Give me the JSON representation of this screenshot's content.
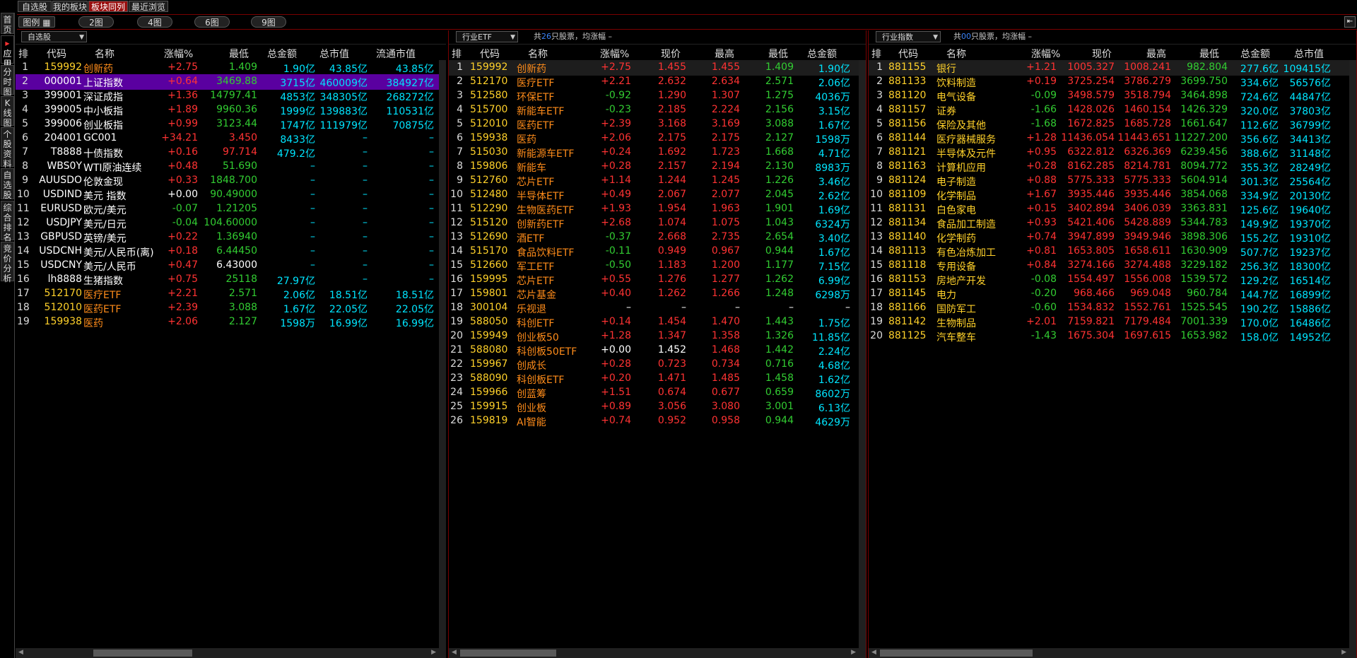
{
  "top_tabs": [
    "自选股",
    "我的板块",
    "板块同列",
    "最近浏览"
  ],
  "active_top_tab": 2,
  "bar2": {
    "legend": "图例 ▦",
    "views": [
      "2图",
      "4图",
      "6图",
      "9图"
    ]
  },
  "left_tabs": [
    "首页",
    "应用",
    "分时图",
    "K线图",
    "个股资料",
    "自选股",
    "综合排名",
    "竞价分析"
  ],
  "panels": [
    {
      "dropdown": "自选股",
      "info_prefix": "",
      "info_count": "",
      "info_suffix": "",
      "columns": [
        "排",
        "代码",
        "名称",
        "涨幅%",
        "最低",
        "总金额",
        "总市值",
        "流通市值"
      ],
      "rows": [
        {
          "i": "1",
          "code": "159992",
          "name": "创新药",
          "chg": "+2.75",
          "c1": "1.409",
          "c2": "1.90亿",
          "c3": "43.85亿",
          "c4": "43.85亿"
        },
        {
          "i": "2",
          "code": "000001",
          "name": "上证指数",
          "chg": "+0.64",
          "c1": "3469.88",
          "c2": "3715亿",
          "c3": "460009亿",
          "c4": "384927亿"
        },
        {
          "i": "3",
          "code": "399001",
          "name": "深证成指",
          "chg": "+1.36",
          "c1": "14797.41",
          "c2": "4853亿",
          "c3": "348305亿",
          "c4": "268272亿"
        },
        {
          "i": "4",
          "code": "399005",
          "name": "中小板指",
          "chg": "+1.89",
          "c1": "9960.36",
          "c2": "1999亿",
          "c3": "139883亿",
          "c4": "110531亿"
        },
        {
          "i": "5",
          "code": "399006",
          "name": "创业板指",
          "chg": "+0.99",
          "c1": "3123.44",
          "c2": "1747亿",
          "c3": "111979亿",
          "c4": "70875亿"
        },
        {
          "i": "6",
          "code": "204001",
          "name": "GC001",
          "chg": "+34.21",
          "c1": "3.450",
          "c2": "8433亿",
          "c3": "–",
          "c4": "–"
        },
        {
          "i": "7",
          "code": "T8888",
          "name": "十债指数",
          "chg": "+0.16",
          "c1": "97.714",
          "c2": "479.2亿",
          "c3": "–",
          "c4": "–"
        },
        {
          "i": "8",
          "code": "WBS0Y",
          "name": "WTI原油连续",
          "chg": "+0.48",
          "c1": "51.690",
          "c2": "–",
          "c3": "–",
          "c4": "–"
        },
        {
          "i": "9",
          "code": "AUUSDO",
          "name": "伦敦金现",
          "chg": "+0.33",
          "c1": "1848.700",
          "c2": "–",
          "c3": "–",
          "c4": "–"
        },
        {
          "i": "10",
          "code": "USDIND",
          "name": "美元 指数",
          "chg": "+0.00",
          "c1": "90.49000",
          "c2": "–",
          "c3": "–",
          "c4": "–"
        },
        {
          "i": "11",
          "code": "EURUSD",
          "name": "欧元/美元",
          "chg": "-0.07",
          "c1": "1.21205",
          "c2": "–",
          "c3": "–",
          "c4": "–"
        },
        {
          "i": "12",
          "code": "USDJPY",
          "name": "美元/日元",
          "chg": "-0.04",
          "c1": "104.60000",
          "c2": "–",
          "c3": "–",
          "c4": "–"
        },
        {
          "i": "13",
          "code": "GBPUSD",
          "name": "英镑/美元",
          "chg": "+0.22",
          "c1": "1.36940",
          "c2": "–",
          "c3": "–",
          "c4": "–"
        },
        {
          "i": "14",
          "code": "USDCNH",
          "name": "美元/人民币(离)",
          "chg": "+0.18",
          "c1": "6.44450",
          "c2": "–",
          "c3": "–",
          "c4": "–"
        },
        {
          "i": "15",
          "code": "USDCNY",
          "name": "美元/人民币",
          "chg": "+0.47",
          "c1": "6.43000",
          "c2": "–",
          "c3": "–",
          "c4": "–"
        },
        {
          "i": "16",
          "code": "lh8888",
          "name": "生猪指数",
          "chg": "+0.75",
          "c1": "25118",
          "c2": "27.97亿",
          "c3": "–",
          "c4": "–"
        },
        {
          "i": "17",
          "code": "512170",
          "name": "医疗ETF",
          "chg": "+2.21",
          "c1": "2.571",
          "c2": "2.06亿",
          "c3": "18.51亿",
          "c4": "18.51亿"
        },
        {
          "i": "18",
          "code": "512010",
          "name": "医药ETF",
          "chg": "+2.39",
          "c1": "3.088",
          "c2": "1.67亿",
          "c3": "22.05亿",
          "c4": "22.05亿"
        },
        {
          "i": "19",
          "code": "159938",
          "name": "医药",
          "chg": "+2.06",
          "c1": "2.127",
          "c2": "1598万",
          "c3": "16.99亿",
          "c4": "16.99亿"
        }
      ]
    },
    {
      "dropdown": "行业ETF",
      "info_prefix": "共",
      "info_count": "26",
      "info_suffix": "只股票，均涨幅 –",
      "columns": [
        "排",
        "代码",
        "名称",
        "涨幅%",
        "现价",
        "最高",
        "最低",
        "总金额"
      ],
      "rows": [
        {
          "i": "1",
          "code": "159992",
          "name": "创新药",
          "chg": "+2.75",
          "c1": "1.455",
          "c2": "1.455",
          "c3": "1.409",
          "c4": "1.90亿"
        },
        {
          "i": "2",
          "code": "512170",
          "name": "医疗ETF",
          "chg": "+2.21",
          "c1": "2.632",
          "c2": "2.634",
          "c3": "2.571",
          "c4": "2.06亿"
        },
        {
          "i": "3",
          "code": "512580",
          "name": "环保ETF",
          "chg": "-0.92",
          "c1": "1.290",
          "c2": "1.307",
          "c3": "1.275",
          "c4": "4036万"
        },
        {
          "i": "4",
          "code": "515700",
          "name": "新能车ETF",
          "chg": "-0.23",
          "c1": "2.185",
          "c2": "2.224",
          "c3": "2.156",
          "c4": "3.15亿"
        },
        {
          "i": "5",
          "code": "512010",
          "name": "医药ETF",
          "chg": "+2.39",
          "c1": "3.168",
          "c2": "3.169",
          "c3": "3.088",
          "c4": "1.67亿"
        },
        {
          "i": "6",
          "code": "159938",
          "name": "医药",
          "chg": "+2.06",
          "c1": "2.175",
          "c2": "2.175",
          "c3": "2.127",
          "c4": "1598万"
        },
        {
          "i": "7",
          "code": "515030",
          "name": "新能源车ETF",
          "chg": "+0.24",
          "c1": "1.692",
          "c2": "1.723",
          "c3": "1.668",
          "c4": "4.71亿"
        },
        {
          "i": "8",
          "code": "159806",
          "name": "新能车",
          "chg": "+0.28",
          "c1": "2.157",
          "c2": "2.194",
          "c3": "2.130",
          "c4": "8983万"
        },
        {
          "i": "9",
          "code": "512760",
          "name": "芯片ETF",
          "chg": "+1.14",
          "c1": "1.244",
          "c2": "1.245",
          "c3": "1.226",
          "c4": "3.46亿"
        },
        {
          "i": "10",
          "code": "512480",
          "name": "半导体ETF",
          "chg": "+0.49",
          "c1": "2.067",
          "c2": "2.077",
          "c3": "2.045",
          "c4": "2.62亿"
        },
        {
          "i": "11",
          "code": "512290",
          "name": "生物医药ETF",
          "chg": "+1.93",
          "c1": "1.954",
          "c2": "1.963",
          "c3": "1.901",
          "c4": "1.69亿"
        },
        {
          "i": "12",
          "code": "515120",
          "name": "创新药ETF",
          "chg": "+2.68",
          "c1": "1.074",
          "c2": "1.075",
          "c3": "1.043",
          "c4": "6324万"
        },
        {
          "i": "13",
          "code": "512690",
          "name": "酒ETF",
          "chg": "-0.37",
          "c1": "2.668",
          "c2": "2.735",
          "c3": "2.654",
          "c4": "3.40亿"
        },
        {
          "i": "14",
          "code": "515170",
          "name": "食品饮料ETF",
          "chg": "-0.11",
          "c1": "0.949",
          "c2": "0.967",
          "c3": "0.944",
          "c4": "1.67亿"
        },
        {
          "i": "15",
          "code": "512660",
          "name": "军工ETF",
          "chg": "-0.50",
          "c1": "1.183",
          "c2": "1.200",
          "c3": "1.177",
          "c4": "7.15亿"
        },
        {
          "i": "16",
          "code": "159995",
          "name": "芯片ETF",
          "chg": "+0.55",
          "c1": "1.276",
          "c2": "1.277",
          "c3": "1.262",
          "c4": "6.99亿"
        },
        {
          "i": "17",
          "code": "159801",
          "name": "芯片基金",
          "chg": "+0.40",
          "c1": "1.262",
          "c2": "1.266",
          "c3": "1.248",
          "c4": "6298万"
        },
        {
          "i": "18",
          "code": "300104",
          "name": "乐视退",
          "chg": "–",
          "c1": "–",
          "c2": "–",
          "c3": "–",
          "c4": "–"
        },
        {
          "i": "19",
          "code": "588050",
          "name": "科创ETF",
          "chg": "+0.14",
          "c1": "1.454",
          "c2": "1.470",
          "c3": "1.443",
          "c4": "1.75亿"
        },
        {
          "i": "20",
          "code": "159949",
          "name": "创业板50",
          "chg": "+1.28",
          "c1": "1.347",
          "c2": "1.358",
          "c3": "1.326",
          "c4": "11.85亿"
        },
        {
          "i": "21",
          "code": "588080",
          "name": "科创板50ETF",
          "chg": "+0.00",
          "c1": "1.452",
          "c2": "1.468",
          "c3": "1.442",
          "c4": "2.24亿"
        },
        {
          "i": "22",
          "code": "159967",
          "name": "创成长",
          "chg": "+0.28",
          "c1": "0.723",
          "c2": "0.734",
          "c3": "0.716",
          "c4": "4.68亿"
        },
        {
          "i": "23",
          "code": "588090",
          "name": "科创板ETF",
          "chg": "+0.20",
          "c1": "1.471",
          "c2": "1.485",
          "c3": "1.458",
          "c4": "1.62亿"
        },
        {
          "i": "24",
          "code": "159966",
          "name": "创蓝筹",
          "chg": "+1.51",
          "c1": "0.674",
          "c2": "0.677",
          "c3": "0.659",
          "c4": "8602万"
        },
        {
          "i": "25",
          "code": "159915",
          "name": "创业板",
          "chg": "+0.89",
          "c1": "3.056",
          "c2": "3.080",
          "c3": "3.001",
          "c4": "6.13亿"
        },
        {
          "i": "26",
          "code": "159819",
          "name": "AI智能",
          "chg": "+0.74",
          "c1": "0.952",
          "c2": "0.958",
          "c3": "0.944",
          "c4": "4629万"
        }
      ]
    },
    {
      "dropdown": "行业指数",
      "info_prefix": "共",
      "info_count": "00",
      "info_suffix": "只股票，均涨幅 –",
      "columns": [
        "排",
        "代码",
        "名称",
        "涨幅%",
        "现价",
        "最高",
        "最低",
        "总金额",
        "总市值"
      ],
      "rows": [
        {
          "i": "1",
          "code": "881155",
          "name": "银行",
          "chg": "+1.21",
          "c1": "1005.327",
          "c2": "1008.241",
          "c3": "982.804",
          "c4": "277.6亿",
          "c5": "109415亿"
        },
        {
          "i": "2",
          "code": "881133",
          "name": "饮料制造",
          "chg": "+0.19",
          "c1": "3725.254",
          "c2": "3786.279",
          "c3": "3699.750",
          "c4": "334.6亿",
          "c5": "56576亿"
        },
        {
          "i": "3",
          "code": "881120",
          "name": "电气设备",
          "chg": "-0.09",
          "c1": "3498.579",
          "c2": "3518.794",
          "c3": "3464.898",
          "c4": "724.6亿",
          "c5": "44847亿"
        },
        {
          "i": "4",
          "code": "881157",
          "name": "证券",
          "chg": "-1.66",
          "c1": "1428.026",
          "c2": "1460.154",
          "c3": "1426.329",
          "c4": "320.0亿",
          "c5": "37803亿"
        },
        {
          "i": "5",
          "code": "881156",
          "name": "保险及其他",
          "chg": "-1.68",
          "c1": "1672.825",
          "c2": "1685.728",
          "c3": "1661.647",
          "c4": "112.6亿",
          "c5": "36799亿"
        },
        {
          "i": "6",
          "code": "881144",
          "name": "医疗器械服务",
          "chg": "+1.28",
          "c1": "11436.054",
          "c2": "11443.651",
          "c3": "11227.200",
          "c4": "356.6亿",
          "c5": "34413亿"
        },
        {
          "i": "7",
          "code": "881121",
          "name": "半导体及元件",
          "chg": "+0.95",
          "c1": "6322.812",
          "c2": "6326.369",
          "c3": "6239.456",
          "c4": "388.6亿",
          "c5": "31148亿"
        },
        {
          "i": "8",
          "code": "881163",
          "name": "计算机应用",
          "chg": "+0.28",
          "c1": "8162.285",
          "c2": "8214.781",
          "c3": "8094.772",
          "c4": "355.3亿",
          "c5": "28249亿"
        },
        {
          "i": "9",
          "code": "881124",
          "name": "电子制造",
          "chg": "+0.88",
          "c1": "5775.333",
          "c2": "5775.333",
          "c3": "5604.914",
          "c4": "301.3亿",
          "c5": "25564亿"
        },
        {
          "i": "10",
          "code": "881109",
          "name": "化学制品",
          "chg": "+1.67",
          "c1": "3935.446",
          "c2": "3935.446",
          "c3": "3854.068",
          "c4": "334.9亿",
          "c5": "20130亿"
        },
        {
          "i": "11",
          "code": "881131",
          "name": "白色家电",
          "chg": "+0.15",
          "c1": "3402.894",
          "c2": "3406.039",
          "c3": "3363.831",
          "c4": "125.6亿",
          "c5": "19640亿"
        },
        {
          "i": "12",
          "code": "881134",
          "name": "食品加工制造",
          "chg": "+0.93",
          "c1": "5421.406",
          "c2": "5428.889",
          "c3": "5344.783",
          "c4": "149.9亿",
          "c5": "19370亿"
        },
        {
          "i": "13",
          "code": "881140",
          "name": "化学制药",
          "chg": "+0.74",
          "c1": "3947.899",
          "c2": "3949.946",
          "c3": "3898.306",
          "c4": "155.2亿",
          "c5": "19310亿"
        },
        {
          "i": "14",
          "code": "881113",
          "name": "有色冶炼加工",
          "chg": "+0.81",
          "c1": "1653.805",
          "c2": "1658.611",
          "c3": "1630.909",
          "c4": "507.7亿",
          "c5": "19237亿"
        },
        {
          "i": "15",
          "code": "881118",
          "name": "专用设备",
          "chg": "+0.84",
          "c1": "3274.166",
          "c2": "3274.488",
          "c3": "3229.182",
          "c4": "256.3亿",
          "c5": "18300亿"
        },
        {
          "i": "16",
          "code": "881153",
          "name": "房地产开发",
          "chg": "-0.08",
          "c1": "1554.497",
          "c2": "1556.008",
          "c3": "1539.572",
          "c4": "129.2亿",
          "c5": "16514亿"
        },
        {
          "i": "17",
          "code": "881145",
          "name": "电力",
          "chg": "-0.20",
          "c1": "968.466",
          "c2": "969.048",
          "c3": "960.784",
          "c4": "144.7亿",
          "c5": "16899亿"
        },
        {
          "i": "18",
          "code": "881166",
          "name": "国防军工",
          "chg": "-0.60",
          "c1": "1534.832",
          "c2": "1552.761",
          "c3": "1525.545",
          "c4": "190.2亿",
          "c5": "15886亿"
        },
        {
          "i": "19",
          "code": "881142",
          "name": "生物制品",
          "chg": "+2.01",
          "c1": "7159.821",
          "c2": "7179.484",
          "c3": "7001.339",
          "c4": "170.0亿",
          "c5": "16486亿"
        },
        {
          "i": "20",
          "code": "881125",
          "name": "汽车整车",
          "chg": "-1.43",
          "c1": "1675.304",
          "c2": "1697.615",
          "c3": "1653.982",
          "c4": "158.0亿",
          "c5": "14952亿"
        }
      ]
    }
  ],
  "colors": {
    "up": "#ff3333",
    "down": "#32cd32",
    "volume": "#00e5ff",
    "name": "#ffd12a",
    "fund": "#ff8c1a",
    "selected": "#5a00a0",
    "accent": "#9a1010"
  }
}
